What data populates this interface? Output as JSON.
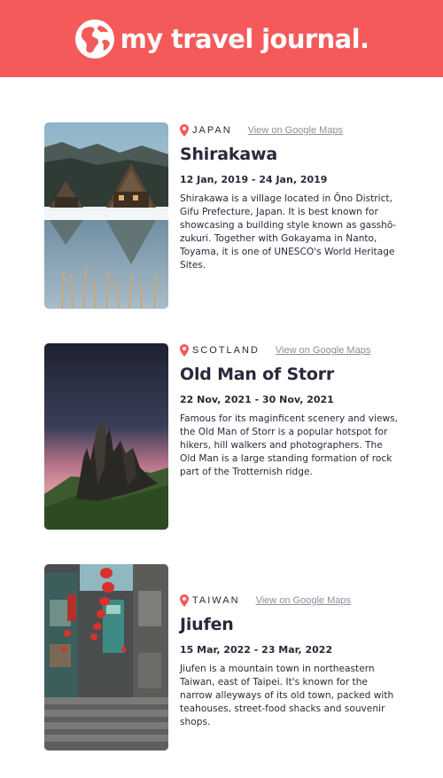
{
  "header": {
    "title": "my travel journal.",
    "logo_icon": "globe-icon",
    "background_color": "#f55a5a"
  },
  "entries": [
    {
      "country": "JAPAN",
      "maps_link": "View on Google Maps",
      "place": "Shirakawa",
      "dates": "12 Jan, 2019 - 24 Jan, 2019",
      "description": "Shirakawa is a village located in Ōno District, Gifu Prefecture, Japan. It is best known for showcasing a building style known as gasshō-zukuri. Together with Gokayama in Nanto, Toyama, it is one of UNESCO's World Heritage Sites."
    },
    {
      "country": "SCOTLAND",
      "maps_link": "View on Google Maps",
      "place": "Old Man of Storr",
      "dates": "22 Nov, 2021 - 30 Nov, 2021",
      "description": "Famous for its maginficent scenery and views, the Old Man of Storr is a popular hotspot for hikers, hill walkers and photographers. The Old Man is a large standing formation of rock part of the Trotternish ridge."
    },
    {
      "country": "TAIWAN",
      "maps_link": "View on Google Maps",
      "place": "Jiufen",
      "dates": "15 Mar, 2022 - 23 Mar, 2022",
      "description": "Jiufen is a mountain town in northeastern Taiwan, east of Taipei. It's known for the narrow alleyways of its old town, packed with teahouses, street-food shacks and souvenir shops."
    }
  ],
  "accent_color": "#f55a5a",
  "link_color": "#918e9b",
  "text_color": "#2b283a"
}
